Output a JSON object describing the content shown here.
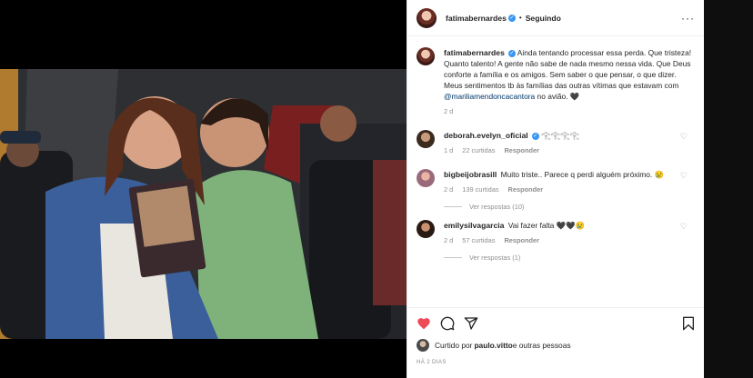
{
  "colors": {
    "verified": "#3897f0",
    "heart_liked": "#ed4956",
    "mention": "#00376b",
    "muted": "#8e8e8e"
  },
  "header": {
    "username": "fatimabernardes",
    "follow_status": "Seguindo",
    "verified_icon": "verified-badge-icon",
    "more_icon": "more-options-icon"
  },
  "caption": {
    "username": "fatimabernardes",
    "text_before": "Ainda tentando processar essa perda. Que tristeza! Quanto talento! A gente não sabe de nada mesmo nessa vida. Que Deus conforte a família e os amigos. Sem saber o que pensar, o que dizer. Meus sentimentos tb às famílias das outras vítimas que estavam com ",
    "mention": "@mariliamendoncacantora",
    "text_after": " no avião. 🖤",
    "time": "2 d"
  },
  "comments": [
    {
      "username": "deborah.evelyn_oficial",
      "verified": true,
      "text": "𓂀𓂀𓂀𓂀",
      "time": "1 d",
      "likes": "22 curtidas",
      "reply": "Responder",
      "replies": ""
    },
    {
      "username": "bigbeijobrasill",
      "verified": false,
      "text": "Muito triste.. Parece q perdi alguém próximo. 😢",
      "time": "2 d",
      "likes": "139 curtidas",
      "reply": "Responder",
      "replies": "Ver respostas (10)"
    },
    {
      "username": "emilysilvagarcia",
      "verified": false,
      "text": "Vai fazer falta 🖤🖤😢",
      "time": "2 d",
      "likes": "57 curtidas",
      "reply": "Responder",
      "replies": "Ver respostas (1)"
    }
  ],
  "actions": {
    "like_icon": "heart-filled-icon",
    "comment_icon": "comment-icon",
    "share_icon": "share-icon",
    "save_icon": "bookmark-icon"
  },
  "liked_by": {
    "prefix": "Curtido por ",
    "user": "paulo.vitto",
    "suffix": " e outras pessoas"
  },
  "timestamp": "HÁ 2 DIAS"
}
